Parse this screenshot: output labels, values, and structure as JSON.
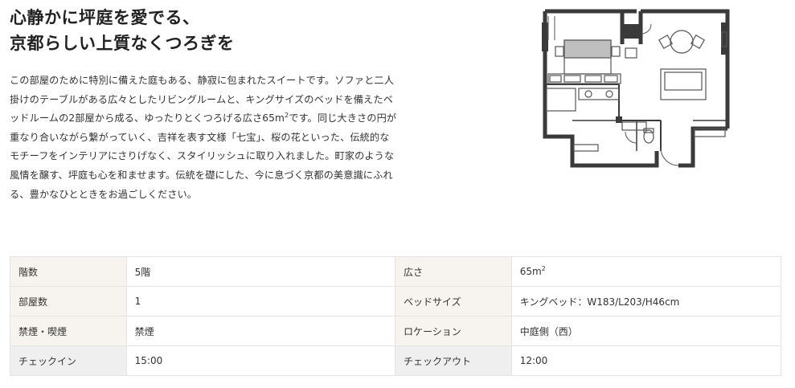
{
  "heading": {
    "line1": "心静かに坪庭を愛でる、",
    "line2": "京都らしい上質なくつろぎを"
  },
  "description": {
    "line1": "この部屋のために特別に備えた庭もある、静寂に包まれたスイートです。ソファと二人",
    "line2": "掛けのテーブルがある広々としたリビングルームと、キングサイズのベッドを備えたベ",
    "line3a": "ッドルームの2部屋から成る、ゆったりとくつろげる広さ65m",
    "line3sup": "2",
    "line3b": "です。同じ大きさの円が",
    "line4": "重なり合いながら繋がっていく、吉祥を表す文様「七宝」、桜の花といった、伝統的な",
    "line5": "モチーフをインテリアにさりげなく、スタイリッシュに取り入れました。町家のような",
    "line6": "風情を醸す、坪庭も心を和ませます。伝統を礎にした、今に息づく京都の美意識にふれ",
    "line7": "る、豊かなひとときをお過ごしください。"
  },
  "specs": {
    "floor_label": "階数",
    "floor_value": "5階",
    "area_label": "広さ",
    "area_value": "65m",
    "area_sup": "2",
    "rooms_label": "部屋数",
    "rooms_value": "1",
    "bed_label": "ベッドサイズ",
    "bed_value": "キングベッド：W183/L203/H46cm",
    "smoking_label": "禁煙・喫煙",
    "smoking_value": "禁煙",
    "location_label": "ロケーション",
    "location_value": "中庭側（西）",
    "checkin_label": "チェックイン",
    "checkin_value": "15:00",
    "checkout_label": "チェックアウト",
    "checkout_value": "12:00"
  },
  "colors": {
    "label_bg": "#f7f4ef",
    "label_bg_alt": "#efefef",
    "border": "#e4e4e4",
    "wall": "#3a3a3a"
  }
}
